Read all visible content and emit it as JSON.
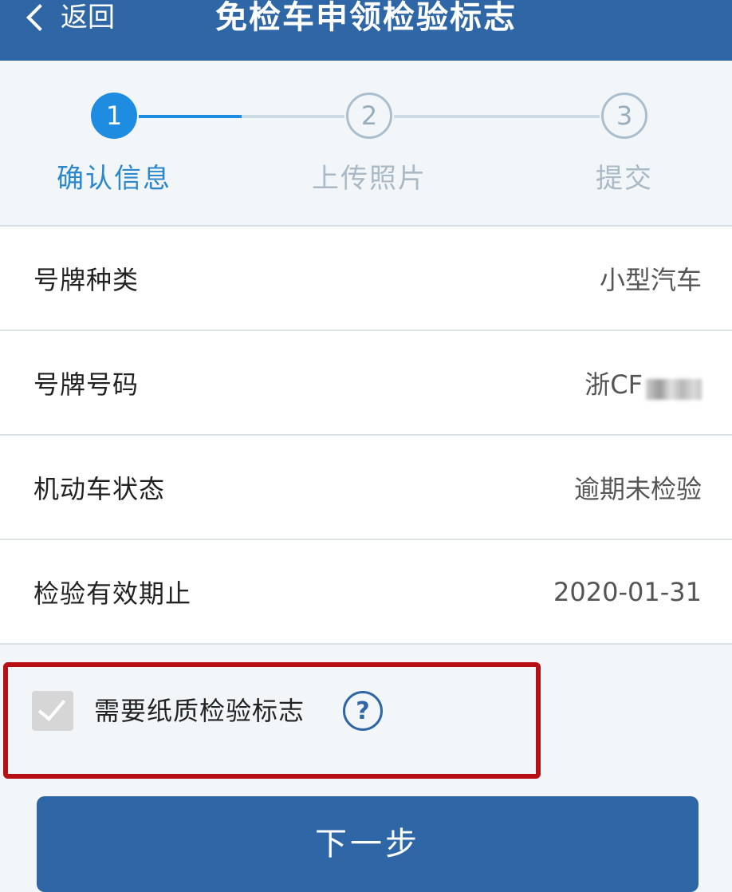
{
  "header": {
    "back_label": "返回",
    "title": "免检车申领检验标志",
    "color": "#2f66a5"
  },
  "steps": [
    {
      "number": "1",
      "label": "确认信息",
      "state": "active"
    },
    {
      "number": "2",
      "label": "上传照片",
      "state": "pending"
    },
    {
      "number": "3",
      "label": "提交",
      "state": "pending"
    }
  ],
  "info_rows": [
    {
      "label": "号牌种类",
      "value": "小型汽车"
    },
    {
      "label": "号牌号码",
      "value": "浙CF"
    },
    {
      "label": "机动车状态",
      "value": "逾期未检验"
    },
    {
      "label": "检验有效期止",
      "value": "2020-01-31"
    }
  ],
  "paper_label_option": {
    "label": "需要纸质检验标志",
    "checked": true,
    "disabled": true,
    "help_icon": "question-circle-icon"
  },
  "next_button": {
    "label": "下一步"
  },
  "colors": {
    "accent": "#1e8ce0",
    "highlight_border": "#b60f14"
  }
}
